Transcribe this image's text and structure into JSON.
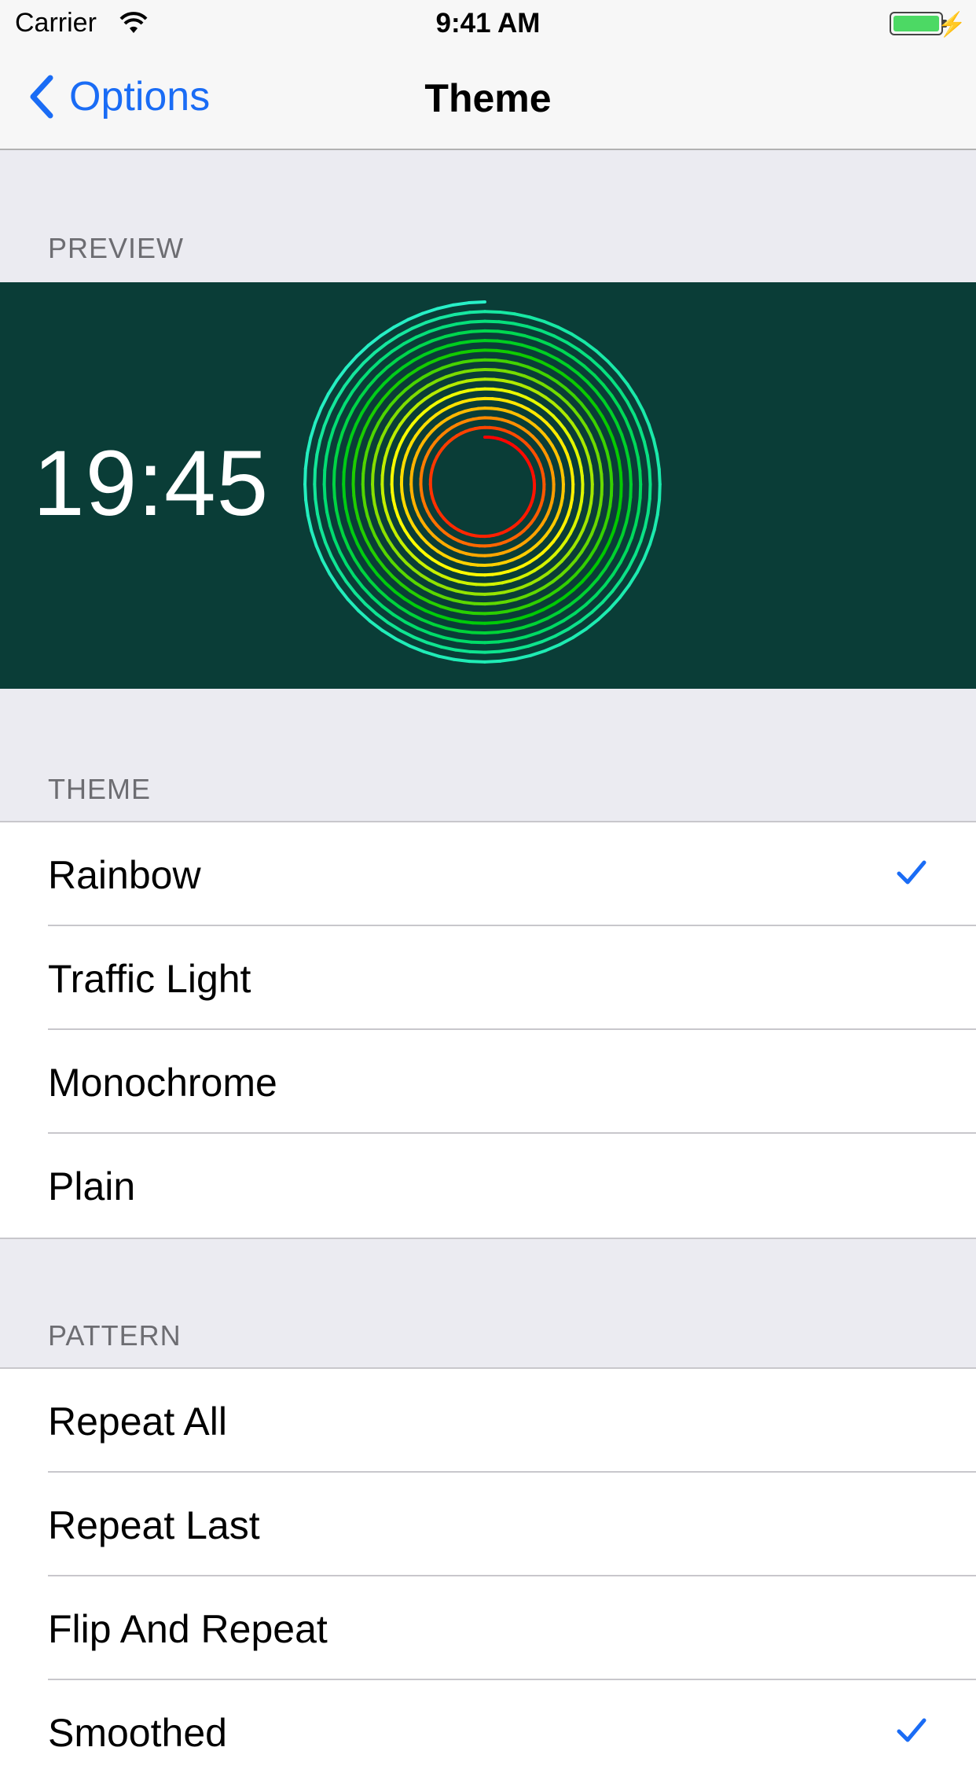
{
  "status": {
    "carrier": "Carrier",
    "time": "9:41 AM"
  },
  "nav": {
    "back_label": "Options",
    "title": "Theme"
  },
  "preview": {
    "header": "PREVIEW",
    "time": "19:45"
  },
  "theme": {
    "header": "THEME",
    "items": [
      {
        "label": "Rainbow",
        "checked": true
      },
      {
        "label": "Traffic Light",
        "checked": false
      },
      {
        "label": "Monochrome",
        "checked": false
      },
      {
        "label": "Plain",
        "checked": false
      }
    ]
  },
  "pattern": {
    "header": "PATTERN",
    "items": [
      {
        "label": "Repeat All",
        "checked": false
      },
      {
        "label": "Repeat Last",
        "checked": false
      },
      {
        "label": "Flip And Repeat",
        "checked": false
      },
      {
        "label": "Smoothed",
        "checked": true
      }
    ]
  },
  "colors": {
    "accent": "#1a6cf5",
    "preview_bg": "#0a3d37"
  }
}
